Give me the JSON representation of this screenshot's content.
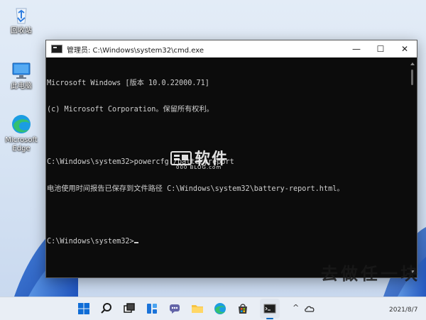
{
  "desktop": {
    "icons": [
      {
        "label": "回收站",
        "icon": "recycle-bin-icon"
      },
      {
        "label": "此电脑",
        "icon": "this-pc-icon"
      },
      {
        "label": "Microsoft Edge",
        "icon": "edge-icon"
      }
    ]
  },
  "window": {
    "title": "管理员: C:\\Windows\\system32\\cmd.exe",
    "minimize_glyph": "—",
    "maximize_glyph": "☐",
    "close_glyph": "✕",
    "console_lines": [
      "Microsoft Windows [版本 10.0.22000.71]",
      "(c) Microsoft Corporation。保留所有权利。",
      "",
      "C:\\Windows\\system32>powercfg /batteryreport",
      "电池使用时间报告已保存到文件路径 C:\\Windows\\system32\\battery-report.html。",
      "",
      "C:\\Windows\\system32>"
    ]
  },
  "watermark": {
    "main": "软件",
    "sub": "000 BLOG.com"
  },
  "overlay": {
    "text": "去做任一块"
  },
  "taskbar": {
    "apps": [
      "start-icon",
      "search-icon",
      "task-view-icon",
      "widgets-icon",
      "chat-icon",
      "file-explorer-icon",
      "edge-icon",
      "store-icon",
      "office-icon",
      "cmd-icon"
    ],
    "tray": {
      "chevron": "^",
      "date": "2021/8/7"
    }
  },
  "colors": {
    "accent": "#0067c0",
    "console_bg": "#0c0c0c",
    "console_fg": "#cfcfcf"
  }
}
